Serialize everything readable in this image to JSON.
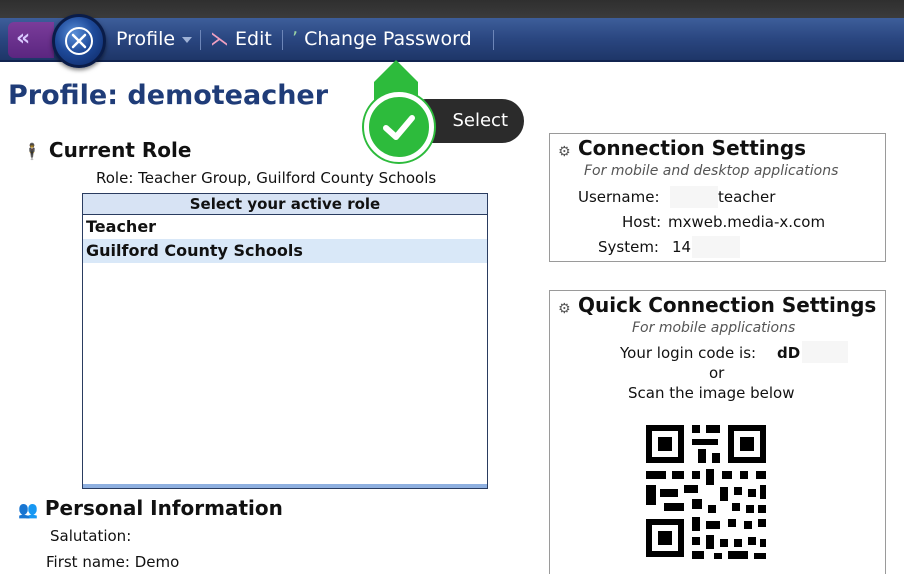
{
  "nav": {
    "back_icon": "chevrons-left-icon",
    "logo_icon": "mediax-logo-icon",
    "items": [
      {
        "label": "Profile",
        "icon": "none"
      },
      {
        "label": "Edit",
        "icon": "pencil-icon"
      },
      {
        "label": "Change Password",
        "icon": "key-icon"
      }
    ]
  },
  "tooltip": {
    "label": "Select"
  },
  "page": {
    "title": "Profile: demoteacher"
  },
  "current_role": {
    "heading": "Current Role",
    "role_text": "Role: Teacher Group, Guilford County Schools",
    "select_header": "Select your active role",
    "options": [
      "Teacher",
      "Guilford County Schools"
    ],
    "selected_index": 1
  },
  "personal": {
    "heading": "Personal Information",
    "fields": [
      "Salutation:",
      "First name: Demo"
    ]
  },
  "connection": {
    "title": "Connection Settings",
    "subtitle": "For mobile and desktop applications",
    "username_label": "Username:",
    "username_value": "teacher",
    "host_label": "Host:",
    "host_value": "mxweb.media-x.com",
    "system_label": "System:",
    "system_value": "14"
  },
  "quick": {
    "title": "Quick Connection Settings",
    "subtitle": "For mobile applications",
    "code_label": "Your login code is:",
    "code_value": "dD",
    "or_text": "or",
    "scan_text": "Scan the image below"
  },
  "colors": {
    "accent": "#1f3c78",
    "nav": "#2a4680",
    "tooltip_green": "#2dbb3c"
  }
}
